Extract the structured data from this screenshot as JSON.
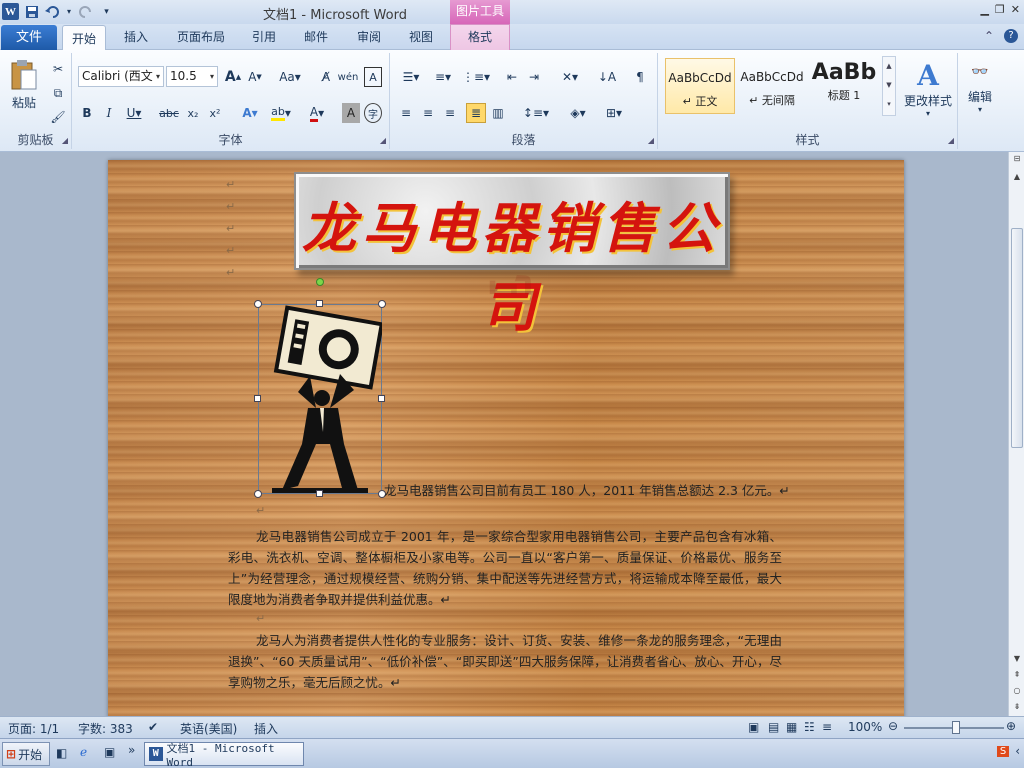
{
  "titlebar": {
    "title": "文档1  -  Microsoft Word",
    "picture_tools": "图片工具",
    "qat_icons": [
      "word-logo-icon",
      "save-icon",
      "undo-icon",
      "redo-icon",
      "customize-qat-icon"
    ]
  },
  "tabs": {
    "file": "文件",
    "items": [
      "开始",
      "插入",
      "页面布局",
      "引用",
      "邮件",
      "审阅",
      "视图"
    ],
    "active_index": 0,
    "format": "格式"
  },
  "ribbon": {
    "clipboard": {
      "paste": "粘贴",
      "label": "剪贴板"
    },
    "font": {
      "family": "Calibri (西文",
      "size": "10.5",
      "label": "字体"
    },
    "paragraph": {
      "label": "段落"
    },
    "styles": {
      "label": "样式",
      "items": [
        {
          "sample": "AaBbCcDd",
          "name": "↵ 正文"
        },
        {
          "sample": "AaBbCcDd",
          "name": "↵ 无间隔"
        },
        {
          "sample": "AaBb",
          "name": "标题 1"
        }
      ],
      "change": "更改样式"
    },
    "editing": {
      "label": "编辑"
    }
  },
  "document": {
    "banner_text": "龙马电器销售公司",
    "caption": "龙马电器销售公司目前有员工 180 人，2011 年销售总额达 2.3 亿元。↵",
    "para1": "龙马电器销售公司成立于 2001 年，是一家综合型家用电器销售公司，主要产品包含有冰箱、彩电、洗衣机、空调、整体橱柜及小家电等。公司一直以“客户第一、质量保证、价格最优、服务至上”为经营理念，通过规模经营、统购分销、集中配送等先进经营方式，将运输成本降至最低，最大限度地为消费者争取并提供利益优惠。↵",
    "para2": "龙马人为消费者提供人性化的专业服务：设计、订货、安装、维修一条龙的服务理念，“无理由退换”、“60 天质量试用”、“低价补偿”、“即买即送”四大服务保障，让消费者省心、放心、开心，尽享购物之乐，毫无后顾之忧。↵"
  },
  "status": {
    "page": "页面: 1/1",
    "words": "字数: 383",
    "language": "英语(美国)",
    "mode": "插入",
    "zoom": "100%"
  },
  "taskbar": {
    "start": "开始",
    "window": "文档1 - Microsoft Word"
  },
  "colors": {
    "accent": "#2b5797",
    "banner_text": "#d4140e",
    "picture_tools": "#d766b8"
  }
}
